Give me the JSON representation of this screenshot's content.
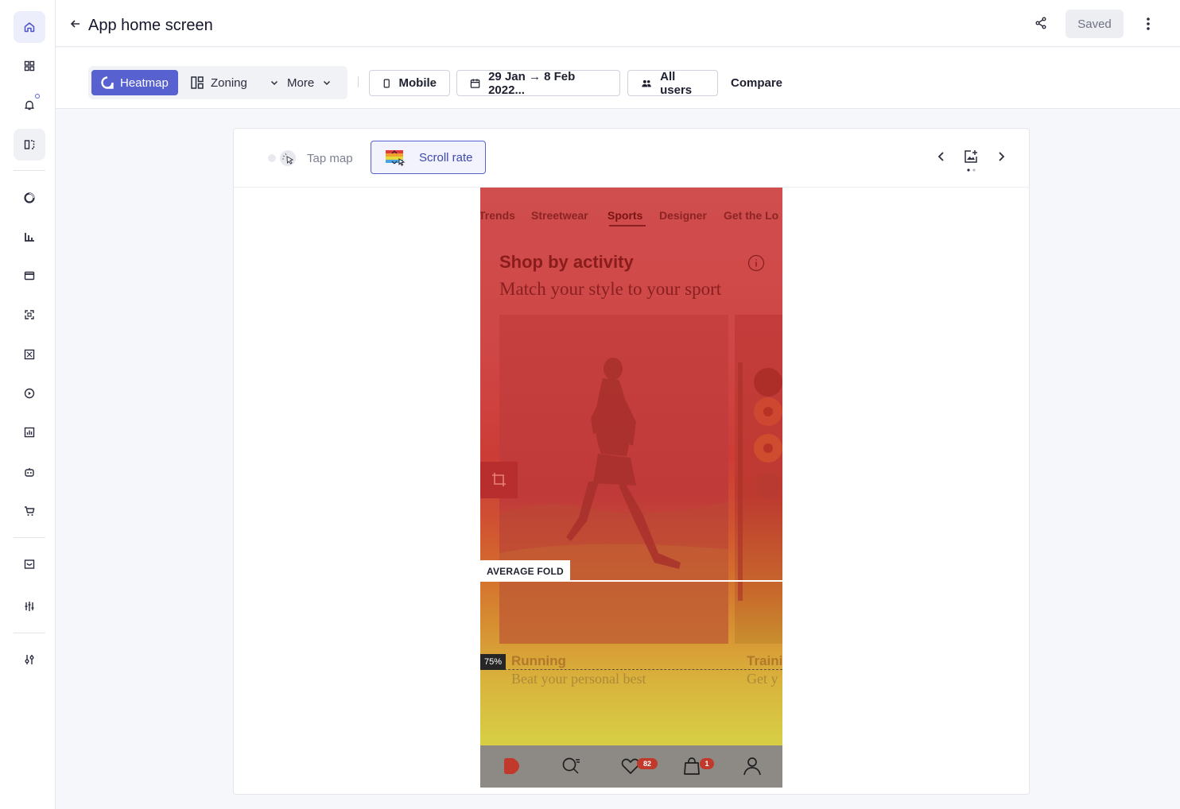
{
  "header": {
    "title": "App home screen",
    "saved_label": "Saved"
  },
  "toolbar": {
    "heatmap_label": "Heatmap",
    "zoning_label": "Zoning",
    "more_label": "More",
    "device_label": "Mobile",
    "date_range_label": "29 Jan → 8 Feb 2022...",
    "segment_label": "All users",
    "compare_label": "Compare"
  },
  "card": {
    "tap_map_label": "Tap map",
    "scroll_rate_label": "Scroll rate"
  },
  "phone": {
    "tabs": [
      "Trends",
      "Streetwear",
      "Sports",
      "Designer",
      "Get the Lo"
    ],
    "active_tab": "Sports",
    "section_title": "Shop by activity",
    "section_subtitle": "Match your style to your sport",
    "average_fold_label": "AVERAGE FOLD",
    "percent_label": "75%",
    "card1_title": "Running",
    "card1_subtitle": "Beat your personal best",
    "card2_title": "Traini",
    "card2_subtitle": "Get y",
    "wishlist_badge": "82",
    "bag_badge": "1"
  },
  "colors": {
    "accent": "#5861d0",
    "heat_hot": "#cc3c36",
    "heat_cold": "#d6d24a"
  }
}
